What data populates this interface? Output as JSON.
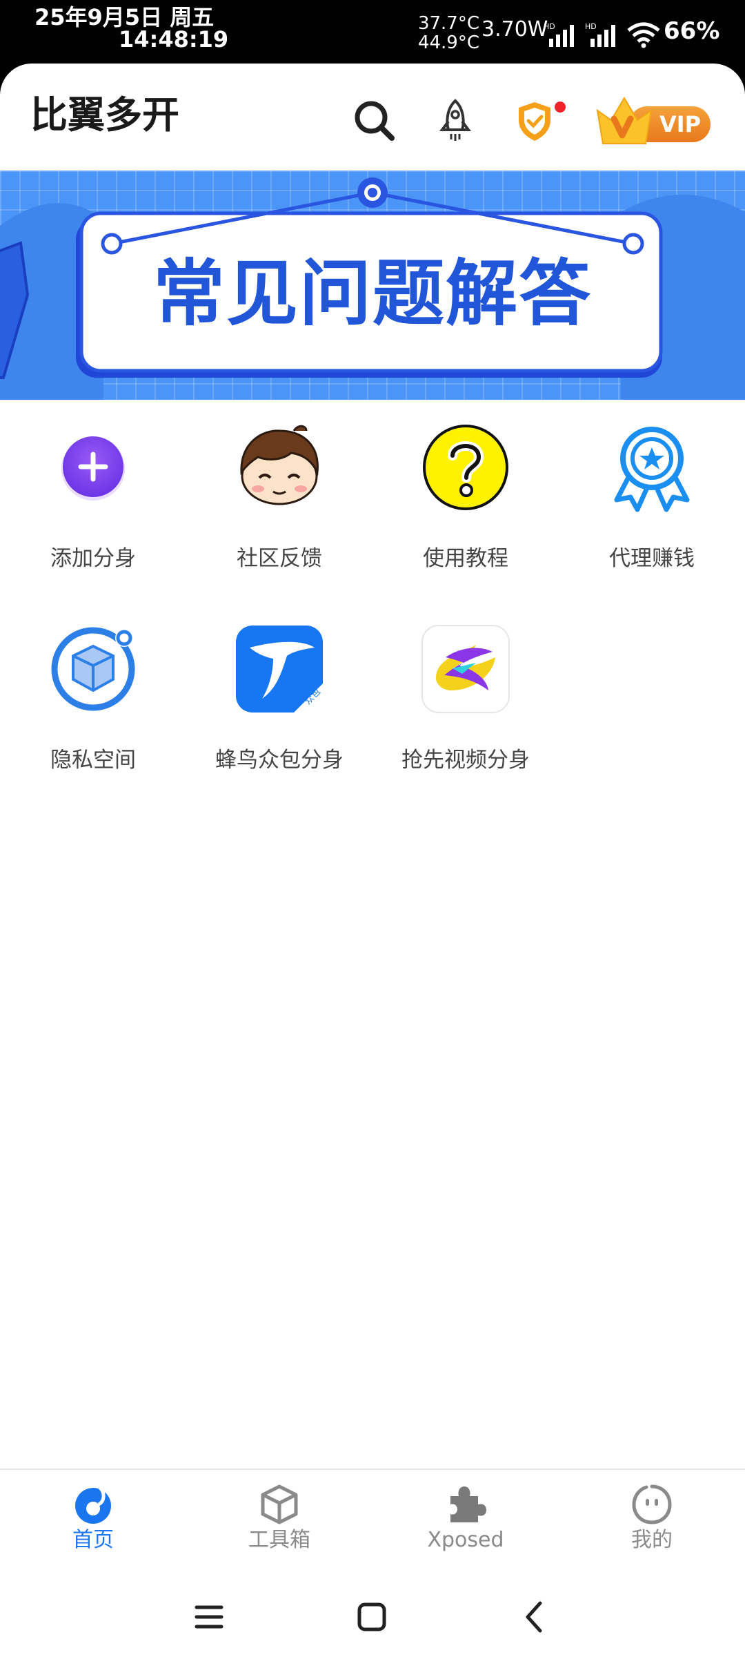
{
  "status_bar": {
    "date": "25年9月5日 周五",
    "time": "14:48:19",
    "temp_1": "37.7°C",
    "temp_2": "44.9°C",
    "power": "3.70W",
    "hd_1": "HD",
    "hd_2": "HD",
    "battery": "66%"
  },
  "header": {
    "title": "比翼多开",
    "vip_label": "VIP",
    "icons": [
      "search-icon",
      "rocket-icon",
      "shield-icon",
      "vip-crown-icon"
    ]
  },
  "banner": {
    "title": "常见问题解答",
    "colors": {
      "background": "#4a95f6",
      "text": "#2256d8"
    }
  },
  "grid": {
    "items": [
      {
        "label": "添加分身",
        "icon": "add-plus-icon"
      },
      {
        "label": "社区反馈",
        "icon": "cartoon-boy-icon"
      },
      {
        "label": "使用教程",
        "icon": "question-mark-icon"
      },
      {
        "label": "代理赚钱",
        "icon": "award-ribbon-icon"
      },
      {
        "label": "隐私空间",
        "icon": "cube-box-icon"
      },
      {
        "label": "蜂鸟众包分身",
        "icon": "hummingbird-app-icon"
      },
      {
        "label": "抢先视频分身",
        "icon": "video-app-icon"
      }
    ],
    "badge_text": "众包"
  },
  "bottom_nav": {
    "items": [
      {
        "label": "首页",
        "icon": "home-icon",
        "active": true
      },
      {
        "label": "工具箱",
        "icon": "toolbox-icon",
        "active": false
      },
      {
        "label": "Xposed",
        "icon": "puzzle-icon",
        "active": false
      },
      {
        "label": "我的",
        "icon": "face-icon",
        "active": false
      }
    ],
    "active_color": "#1976f0"
  },
  "system_nav": [
    "menu-icon",
    "home-square-icon",
    "back-icon"
  ]
}
